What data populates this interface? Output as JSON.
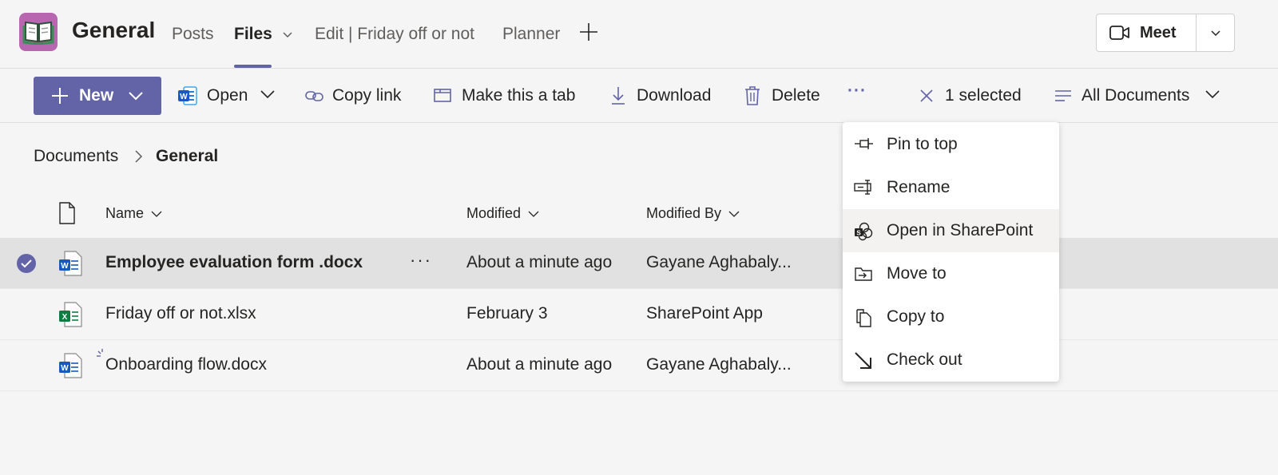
{
  "header": {
    "team_name": "General",
    "tabs": [
      {
        "label": "Posts"
      },
      {
        "label": "Files"
      },
      {
        "label": "Edit | Friday off or not"
      },
      {
        "label": "Planner"
      }
    ],
    "meet_label": "Meet"
  },
  "toolbar": {
    "new_label": "New",
    "open_label": "Open",
    "copy_link_label": "Copy link",
    "make_tab_label": "Make this a tab",
    "download_label": "Download",
    "delete_label": "Delete",
    "more_label": "···",
    "selected_label": "1 selected",
    "view_label": "All Documents"
  },
  "breadcrumb": {
    "root": "Documents",
    "current": "General"
  },
  "table": {
    "columns": [
      {
        "label": "Name"
      },
      {
        "label": "Modified"
      },
      {
        "label": "Modified By"
      }
    ],
    "rows": [
      {
        "name": "Employee evaluation form .docx",
        "modified": "About a minute ago",
        "modified_by": "Gayane Aghabaly...",
        "type": "word",
        "selected": true
      },
      {
        "name": "Friday off or not.xlsx",
        "modified": "February 3",
        "modified_by": "SharePoint App",
        "type": "excel",
        "selected": false
      },
      {
        "name": "Onboarding flow.docx",
        "modified": "About a minute ago",
        "modified_by": "Gayane Aghabaly...",
        "type": "word",
        "selected": false
      }
    ],
    "row_more": "···"
  },
  "context_menu": {
    "items": [
      {
        "label": "Pin to top",
        "icon": "pin-icon"
      },
      {
        "label": "Rename",
        "icon": "rename-icon"
      },
      {
        "label": "Open in SharePoint",
        "icon": "sharepoint-icon"
      },
      {
        "label": "Move to",
        "icon": "move-icon"
      },
      {
        "label": "Copy to",
        "icon": "copy-icon"
      },
      {
        "label": "Check out",
        "icon": "check-out-icon"
      }
    ]
  },
  "colors": {
    "accent": "#6264a7",
    "team_icon": "#b866b0",
    "word": "#185abd",
    "excel": "#107c41"
  }
}
